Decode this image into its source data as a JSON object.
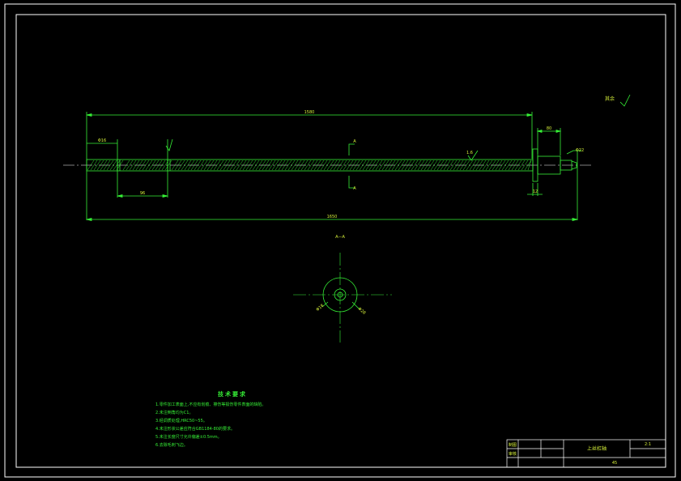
{
  "colors": {
    "background": "#000000",
    "frame": "#ffffff",
    "line": "#36f036",
    "label": "#d6f03a"
  },
  "drawing": {
    "section_mark_top": "A",
    "section_mark_bottom": "A",
    "section_view_label": "A—A",
    "roughness_note": "其余"
  },
  "dimensions": {
    "overall_length_top": "1580",
    "overall_length_bottom": "1650",
    "left_end_diameter": "Φ16",
    "left_segment_length": "96",
    "right_head_length": "80",
    "right_end_diameter": "Φ22",
    "flange_width": "12",
    "thread_roughness": "1.6",
    "section_dim_left": "Φ18",
    "section_dim_right": "Φ28"
  },
  "notes": {
    "title": "技术要求",
    "lines": [
      "1.零件加工表面上,不应有划痕、擦伤等损伤零件表面的缺陷。",
      "2.未注倒角均为C1。",
      "3.经调质处理,HRC50~55。",
      "4.未注形状公差应符合GB1184-80的要求。",
      "5.未注长度尺寸允许偏差±0.5mm。",
      "6.去除毛刺飞边。"
    ]
  },
  "title_block": {
    "part_name": "上丝杠轴",
    "scale": "2:1",
    "material": "45",
    "row_label_1": "制图",
    "row_label_2": "审核"
  }
}
